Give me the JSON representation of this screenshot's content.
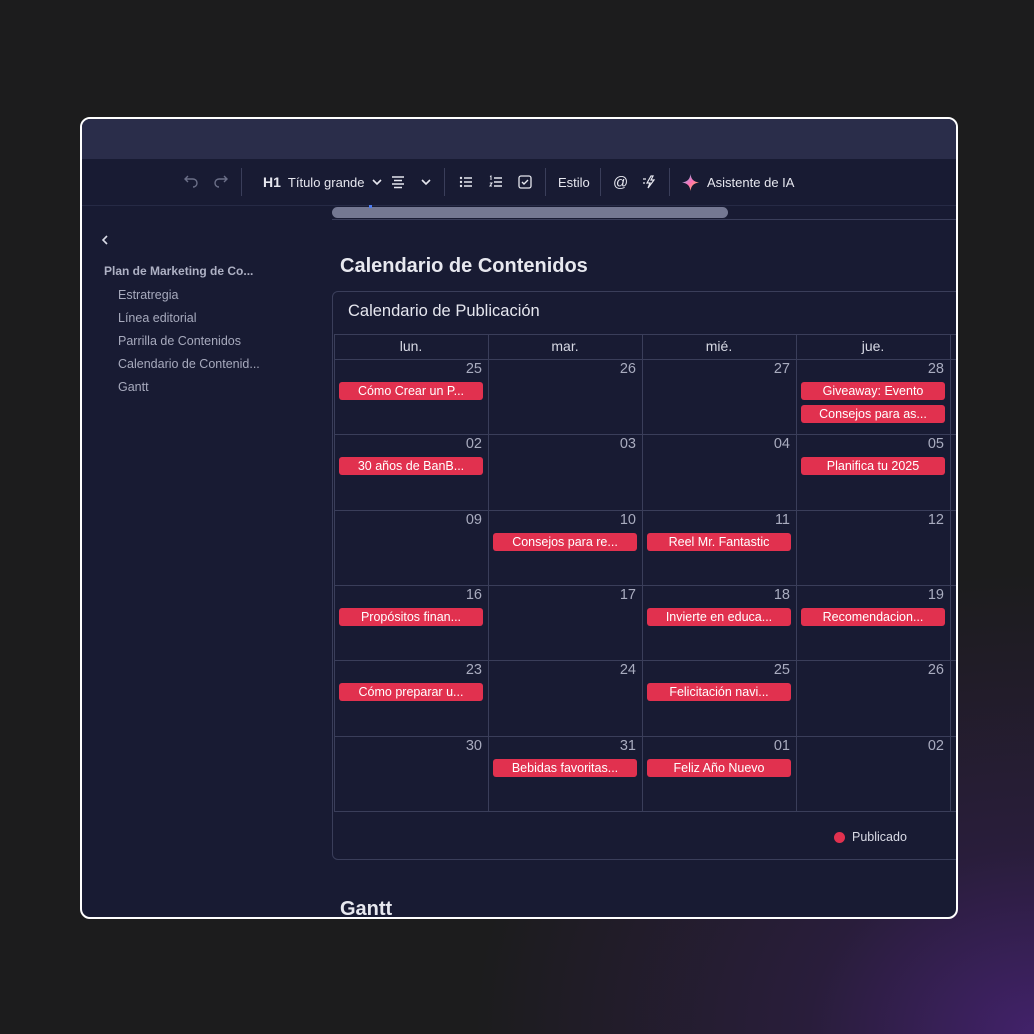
{
  "toolbar": {
    "heading_level": "H1",
    "heading_style": "Título grande",
    "style_label": "Estilo",
    "mention_symbol": "@",
    "ai_label": "Asistente de IA"
  },
  "sidebar": {
    "root": "Plan de Marketing de Co...",
    "items": [
      {
        "label": "Estratregia"
      },
      {
        "label": "Línea editorial"
      },
      {
        "label": "Parrilla de Contenidos"
      },
      {
        "label": "Calendario de Contenid..."
      },
      {
        "label": "Gantt"
      }
    ]
  },
  "main": {
    "calendar_heading": "Calendario de Contenidos",
    "gantt_heading": "Gantt"
  },
  "calendar": {
    "title": "Calendario de Publicación",
    "weekdays": [
      "lun.",
      "mar.",
      "mié.",
      "jue."
    ],
    "weeks": [
      [
        {
          "day": "25",
          "events": [
            "Cómo Crear un P..."
          ]
        },
        {
          "day": "26",
          "events": []
        },
        {
          "day": "27",
          "events": []
        },
        {
          "day": "28",
          "events": [
            "Giveaway: Evento",
            "Consejos para as..."
          ]
        }
      ],
      [
        {
          "day": "02",
          "events": [
            "30 años de BanB..."
          ]
        },
        {
          "day": "03",
          "events": []
        },
        {
          "day": "04",
          "events": []
        },
        {
          "day": "05",
          "events": [
            "Planifica tu 2025"
          ]
        }
      ],
      [
        {
          "day": "09",
          "events": []
        },
        {
          "day": "10",
          "events": [
            "Consejos para re..."
          ]
        },
        {
          "day": "11",
          "events": [
            "Reel Mr. Fantastic"
          ]
        },
        {
          "day": "12",
          "events": []
        }
      ],
      [
        {
          "day": "16",
          "events": [
            "Propósitos finan..."
          ]
        },
        {
          "day": "17",
          "events": []
        },
        {
          "day": "18",
          "events": [
            "Invierte en educa..."
          ]
        },
        {
          "day": "19",
          "events": [
            "Recomendacion..."
          ]
        }
      ],
      [
        {
          "day": "23",
          "events": [
            "Cómo preparar u..."
          ]
        },
        {
          "day": "24",
          "events": []
        },
        {
          "day": "25",
          "events": [
            "Felicitación navi..."
          ]
        },
        {
          "day": "26",
          "events": []
        }
      ],
      [
        {
          "day": "30",
          "events": []
        },
        {
          "day": "31",
          "events": [
            "Bebidas favoritas..."
          ]
        },
        {
          "day": "01",
          "events": [
            "Feliz Año Nuevo"
          ]
        },
        {
          "day": "02",
          "events": []
        }
      ]
    ],
    "legend": {
      "label": "Publicado",
      "color": "#e1314f"
    }
  },
  "colors": {
    "event": "#e1314f",
    "window_bg": "#181b33",
    "titlebar_bg": "#2a2d4a",
    "page_bg": "#1c1c1d"
  },
  "icons": [
    "undo-icon",
    "redo-icon",
    "chevron-down-icon",
    "align-icon",
    "bullet-list-icon",
    "numbered-list-icon",
    "checklist-icon",
    "mention-icon",
    "magic-icon",
    "sparkle-icon",
    "back-icon"
  ]
}
